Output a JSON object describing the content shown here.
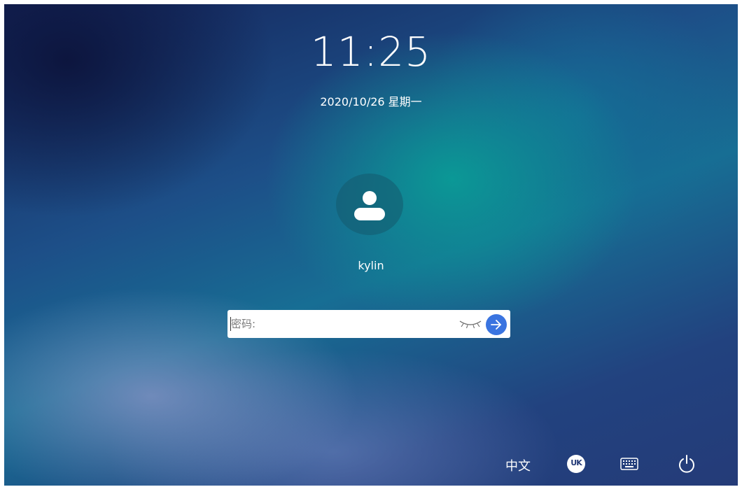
{
  "lockscreen": {
    "time": "11:25",
    "date": "2020/10/26 星期一",
    "username": "kylin"
  },
  "login": {
    "password_placeholder": "密码:",
    "password_value": "",
    "show_password_icon": "eye-closed-icon",
    "submit_icon": "arrow-right-icon"
  },
  "bottom_bar": {
    "language_label": "中文",
    "keyboard_layout_label": "UK",
    "onscreen_keyboard_icon": "keyboard-icon",
    "power_icon": "power-icon"
  },
  "colors": {
    "accent": "#3a74e0",
    "text": "#ffffff",
    "input_background": "#ffffff"
  }
}
